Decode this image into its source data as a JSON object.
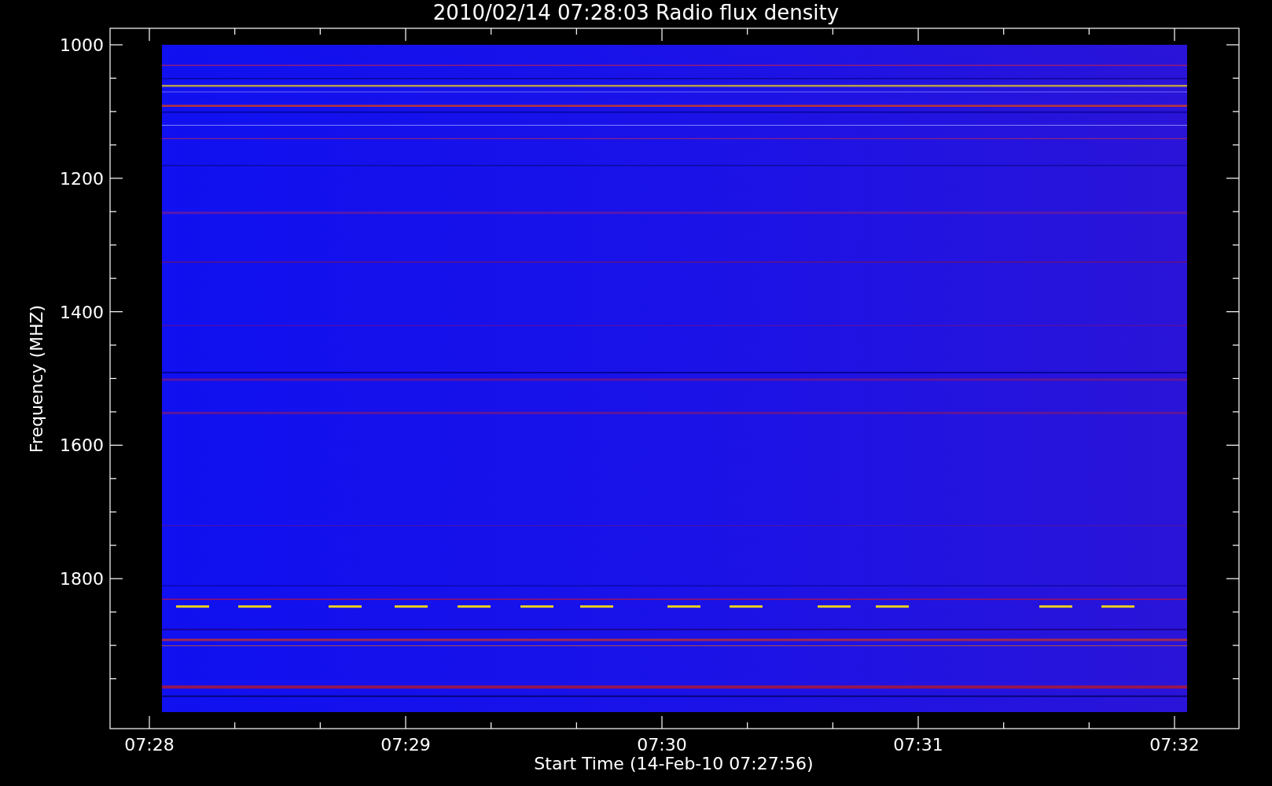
{
  "title": "2010/02/14 07:28:03 Radio flux density",
  "plot": {
    "xlabel": "Start Time (14-Feb-10 07:27:56)",
    "ylabel": "Frequency (MHZ)",
    "yticks": [
      "1000",
      "1200",
      "1400",
      "1600",
      "1800"
    ],
    "xticks": [
      "07:28",
      "07:29",
      "07:30",
      "07:31",
      "07:32"
    ]
  }
}
